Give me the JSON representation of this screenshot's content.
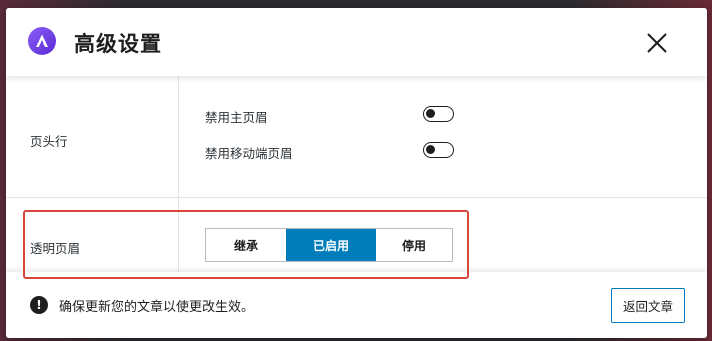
{
  "modal": {
    "title": "高级设置",
    "logo_icon": "astra-logo-icon",
    "close_icon": "close-icon"
  },
  "header_row": {
    "label": "页头行",
    "toggles": [
      {
        "label": "禁用主页眉",
        "checked": false
      },
      {
        "label": "禁用移动端页眉",
        "checked": false
      }
    ]
  },
  "transparent_row": {
    "label": "透明页眉",
    "options": [
      "继承",
      "已启用",
      "停用"
    ],
    "selected": "已启用"
  },
  "footer": {
    "notice_icon": "warning-icon",
    "notice": "确保更新您的文章以使更改生效。",
    "back_button": "返回文章"
  },
  "colors": {
    "accent": "#007cba",
    "highlight_border": "#d9463a",
    "logo": "#7047eb"
  }
}
